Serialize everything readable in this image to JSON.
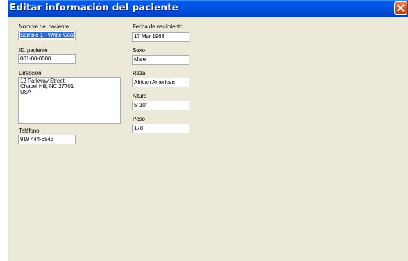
{
  "window": {
    "title": "Editar información del paciente"
  },
  "form": {
    "patient_name": {
      "label": "Nombre del paciente",
      "value": "Sample 1 - White Coat"
    },
    "patient_id": {
      "label": "ID. paciente",
      "value": "001-00-0000"
    },
    "address": {
      "label": "Dirección",
      "value": "12 Parkway Street\nChapel Hill, NC 27701\nUSA"
    },
    "phone": {
      "label": "Teléfono",
      "value": "919 444-6543"
    },
    "birth_date": {
      "label": "Fecha de nacimiento",
      "value": "17 Mar 1968"
    },
    "sex": {
      "label": "Sexo",
      "value": "Male"
    },
    "race": {
      "label": "Raza",
      "value": "African American"
    },
    "height": {
      "label": "Altura",
      "value": "5' 10\""
    },
    "weight": {
      "label": "Peso",
      "value": "178"
    }
  },
  "icons": {
    "close": "close-icon"
  },
  "colors": {
    "titlebar": "#0054e3",
    "window_bg": "#ece9d8",
    "close_button": "#d6572b",
    "selection": "#316ac5"
  }
}
